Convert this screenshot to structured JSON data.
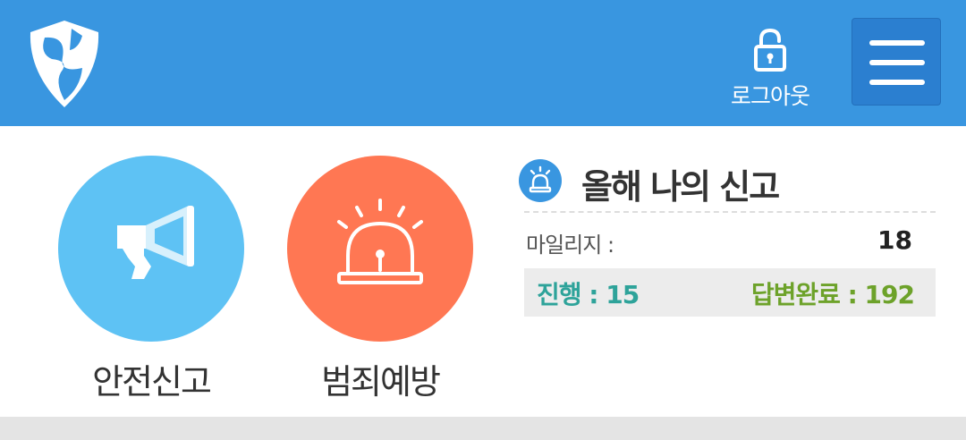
{
  "header": {
    "logo_icon": "shield-logo-icon",
    "logout_icon": "lock-open-icon",
    "logout_label": "로그아웃",
    "menu_icon": "hamburger-menu-icon",
    "background": "#3996e0"
  },
  "tiles": [
    {
      "label": "안전신고",
      "icon": "megaphone-icon",
      "color": "#5ec2f4"
    },
    {
      "label": "범죄예방",
      "icon": "siren-icon",
      "color": "#ff7753"
    }
  ],
  "panel": {
    "icon": "siren-icon",
    "title": "올해 나의 신고",
    "mileage_label": "마일리지 :",
    "mileage_value": "18",
    "progress_text": "진행 : 15",
    "completed_text": "답변완료 : 192",
    "progress_color": "#2ea39a",
    "completed_color": "#6da22a"
  }
}
